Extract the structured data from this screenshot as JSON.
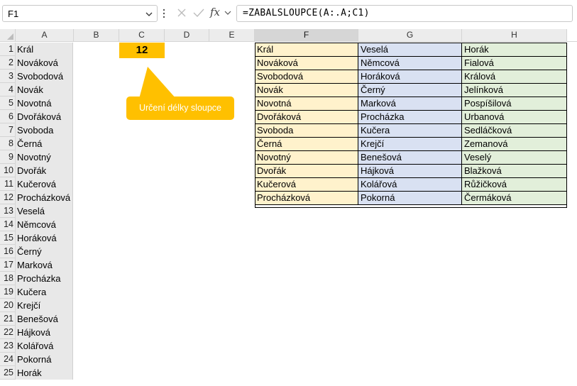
{
  "formula_bar": {
    "cell_ref": "F1",
    "formula": "=ZABALSLOUPCE(A:.A;C1)",
    "fx_label": "fx"
  },
  "columns": [
    "A",
    "B",
    "C",
    "D",
    "E",
    "F",
    "G",
    "H"
  ],
  "rows": [
    "1",
    "2",
    "3",
    "4",
    "5",
    "6",
    "7",
    "8",
    "9",
    "10",
    "11",
    "12",
    "13",
    "14",
    "15",
    "16",
    "17",
    "18",
    "19",
    "20",
    "21",
    "22",
    "23",
    "24",
    "25"
  ],
  "column_a": [
    "Král",
    "Nováková",
    "Svobodová",
    "Novák",
    "Novotná",
    "Dvořáková",
    "Svoboda",
    "Černá",
    "Novotný",
    "Dvořák",
    "Kučerová",
    "Procházková",
    "Veselá",
    "Němcová",
    "Horáková",
    "Černý",
    "Marková",
    "Procházka",
    "Kučera",
    "Krejčí",
    "Benešová",
    "Hájková",
    "Kolářová",
    "Pokorná",
    "Horák"
  ],
  "c1_value": "12",
  "callout_text": "Určení délky sloupce",
  "result_table": {
    "F": [
      "Král",
      "Nováková",
      "Svobodová",
      "Novák",
      "Novotná",
      "Dvořáková",
      "Svoboda",
      "Černá",
      "Novotný",
      "Dvořák",
      "Kučerová",
      "Procházková"
    ],
    "G": [
      "Veselá",
      "Němcová",
      "Horáková",
      "Černý",
      "Marková",
      "Procházka",
      "Kučera",
      "Krejčí",
      "Benešová",
      "Hájková",
      "Kolářová",
      "Pokorná"
    ],
    "H": [
      "Horák",
      "Fialová",
      "Králová",
      "Jelínková",
      "Pospíšilová",
      "Urbanová",
      "Sedláčková",
      "Zemanová",
      "Veselý",
      "Blažková",
      "Růžičková",
      "Čermáková"
    ]
  },
  "colors": {
    "accent": "#ffc000",
    "col_f_fill": "#fff2cc",
    "col_g_fill": "#d9e1f2",
    "col_h_fill": "#e2efda",
    "source_column_fill": "#e8e8e8"
  }
}
